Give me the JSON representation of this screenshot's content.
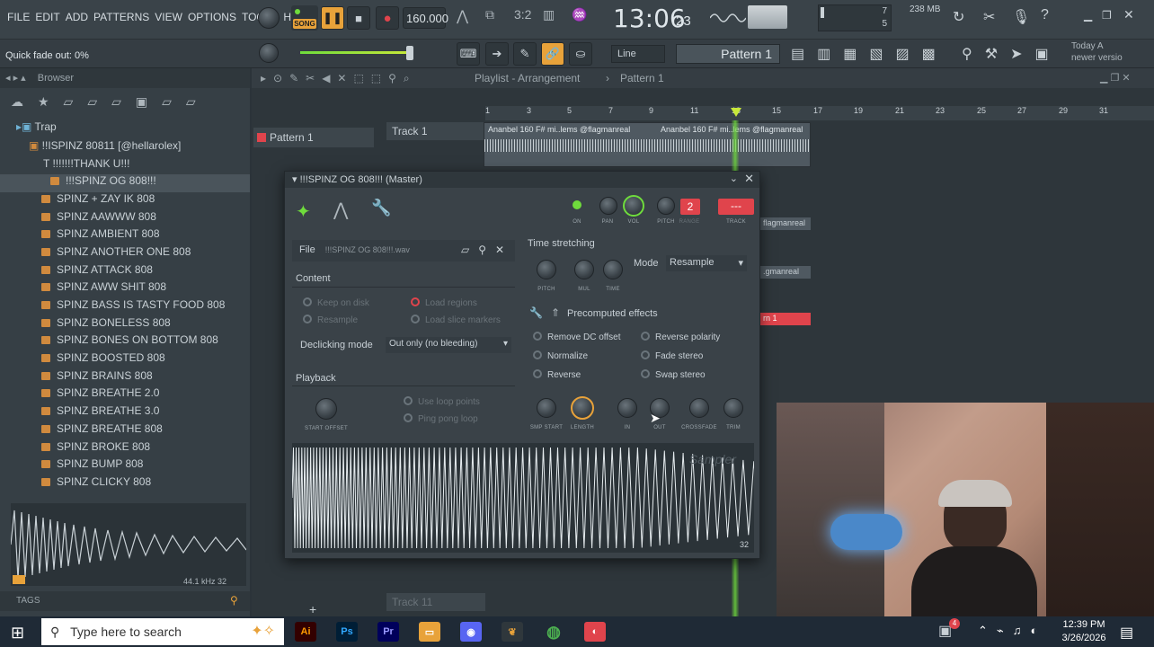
{
  "menu": [
    "FILE",
    "EDIT",
    "ADD",
    "PATTERNS",
    "VIEW",
    "OPTIONS",
    "TOOLS",
    "HELP"
  ],
  "transport": {
    "mode_label": "SONG",
    "tempo": "160.000",
    "time": "13:06",
    "time_small": "23"
  },
  "cpu": {
    "top": "7",
    "mem": "238 MB",
    "bottom": "5"
  },
  "hint": {
    "label": "Quick fade out: 0%"
  },
  "snap": {
    "value": "Line"
  },
  "pattern_selector": {
    "value": "Pattern 1"
  },
  "news": {
    "line1": "Today  A",
    "line2": "newer versio"
  },
  "browser": {
    "title": "Browser",
    "root": "Trap",
    "items": [
      {
        "label": "!!ISPINZ 80811 [@hellarolex]",
        "type": "folder"
      },
      {
        "label": "!!!!!!!THANK U!!!",
        "type": "text"
      },
      {
        "label": "!!!SPINZ OG 808!!!",
        "type": "folder",
        "selected": true
      },
      {
        "label": "SPINZ + ZAY IK 808",
        "type": "file"
      },
      {
        "label": "SPINZ AAWWW 808",
        "type": "file"
      },
      {
        "label": "SPINZ AMBIENT 808",
        "type": "file"
      },
      {
        "label": "SPINZ ANOTHER ONE 808",
        "type": "file"
      },
      {
        "label": "SPINZ ATTACK 808",
        "type": "file"
      },
      {
        "label": "SPINZ AWW SHIT 808",
        "type": "file"
      },
      {
        "label": "SPINZ BASS IS TASTY FOOD 808",
        "type": "file"
      },
      {
        "label": "SPINZ BONELESS 808",
        "type": "file"
      },
      {
        "label": "SPINZ BONES ON BOTTOM 808",
        "type": "file"
      },
      {
        "label": "SPINZ BOOSTED 808",
        "type": "file"
      },
      {
        "label": "SPINZ BRAINS 808",
        "type": "file"
      },
      {
        "label": "SPINZ BREATHE 2.0",
        "type": "file"
      },
      {
        "label": "SPINZ BREATHE 3.0",
        "type": "file"
      },
      {
        "label": "SPINZ BREATHE 808",
        "type": "file"
      },
      {
        "label": "SPINZ BROKE 808",
        "type": "file"
      },
      {
        "label": "SPINZ BUMP 808",
        "type": "file"
      },
      {
        "label": "SPINZ CLICKY 808",
        "type": "file"
      }
    ],
    "preview_info": "44.1 kHz 32",
    "tags_label": "TAGS"
  },
  "playlist": {
    "title": "Playlist - Arrangement",
    "pattern": "Pattern 1",
    "pattern_item": "Pattern 1",
    "ruler": [
      "1",
      "3",
      "5",
      "7",
      "9",
      "11",
      "13",
      "15",
      "17",
      "19",
      "21",
      "23",
      "25",
      "27",
      "29",
      "31"
    ],
    "track1": "Track 1",
    "track11": "Track 11",
    "clip_label": "Ananbel 160 F# mi..lems @flagmanreal",
    "clip_label2": "Ananbel 160 F# mi..lems @flagmanreal",
    "side_labels": [
      "flagmanreal",
      ".gmanreal",
      "rn 1"
    ]
  },
  "sampler": {
    "title": "!!!SPINZ OG 808!!! (Master)",
    "file_label": "File",
    "file_name": "!!!SPINZ OG 808!!!.wav",
    "top_knobs": [
      "ON",
      "PAN",
      "VOL",
      "PITCH",
      "RANGE",
      "TRACK"
    ],
    "range_value": "2",
    "track_value": "---",
    "content_label": "Content",
    "content_opts": [
      "Keep on disk",
      "Load regions",
      "Resample",
      "Load slice markers"
    ],
    "declicking_label": "Declicking mode",
    "declicking_value": "Out only (no bleeding)",
    "playback_label": "Playback",
    "playback_opts": [
      "Use loop points",
      "Ping pong loop"
    ],
    "start_offset": "START OFFSET",
    "time_stretching": "Time stretching",
    "ts_knobs": [
      "PITCH",
      "MUL",
      "TIME"
    ],
    "mode_label": "Mode",
    "mode_value": "Resample",
    "precomputed": "Precomputed effects",
    "effects": [
      "Remove DC offset",
      "Reverse polarity",
      "Normalize",
      "Fade stereo",
      "Reverse",
      "Swap stereo"
    ],
    "bottom_knobs": [
      "SMP START",
      "LENGTH",
      "IN",
      "OUT",
      "CROSSFADE",
      "TRIM"
    ],
    "watermark": "Sampler",
    "bit_depth": "32"
  },
  "taskbar": {
    "search_placeholder": "Type here to search",
    "time": "12:39 PM",
    "date": "3/26/2026",
    "notif": "4"
  },
  "colors": {
    "accent_green": "#6fdc3c",
    "accent_red": "#e0444c",
    "accent_orange": "#e8a23a"
  }
}
